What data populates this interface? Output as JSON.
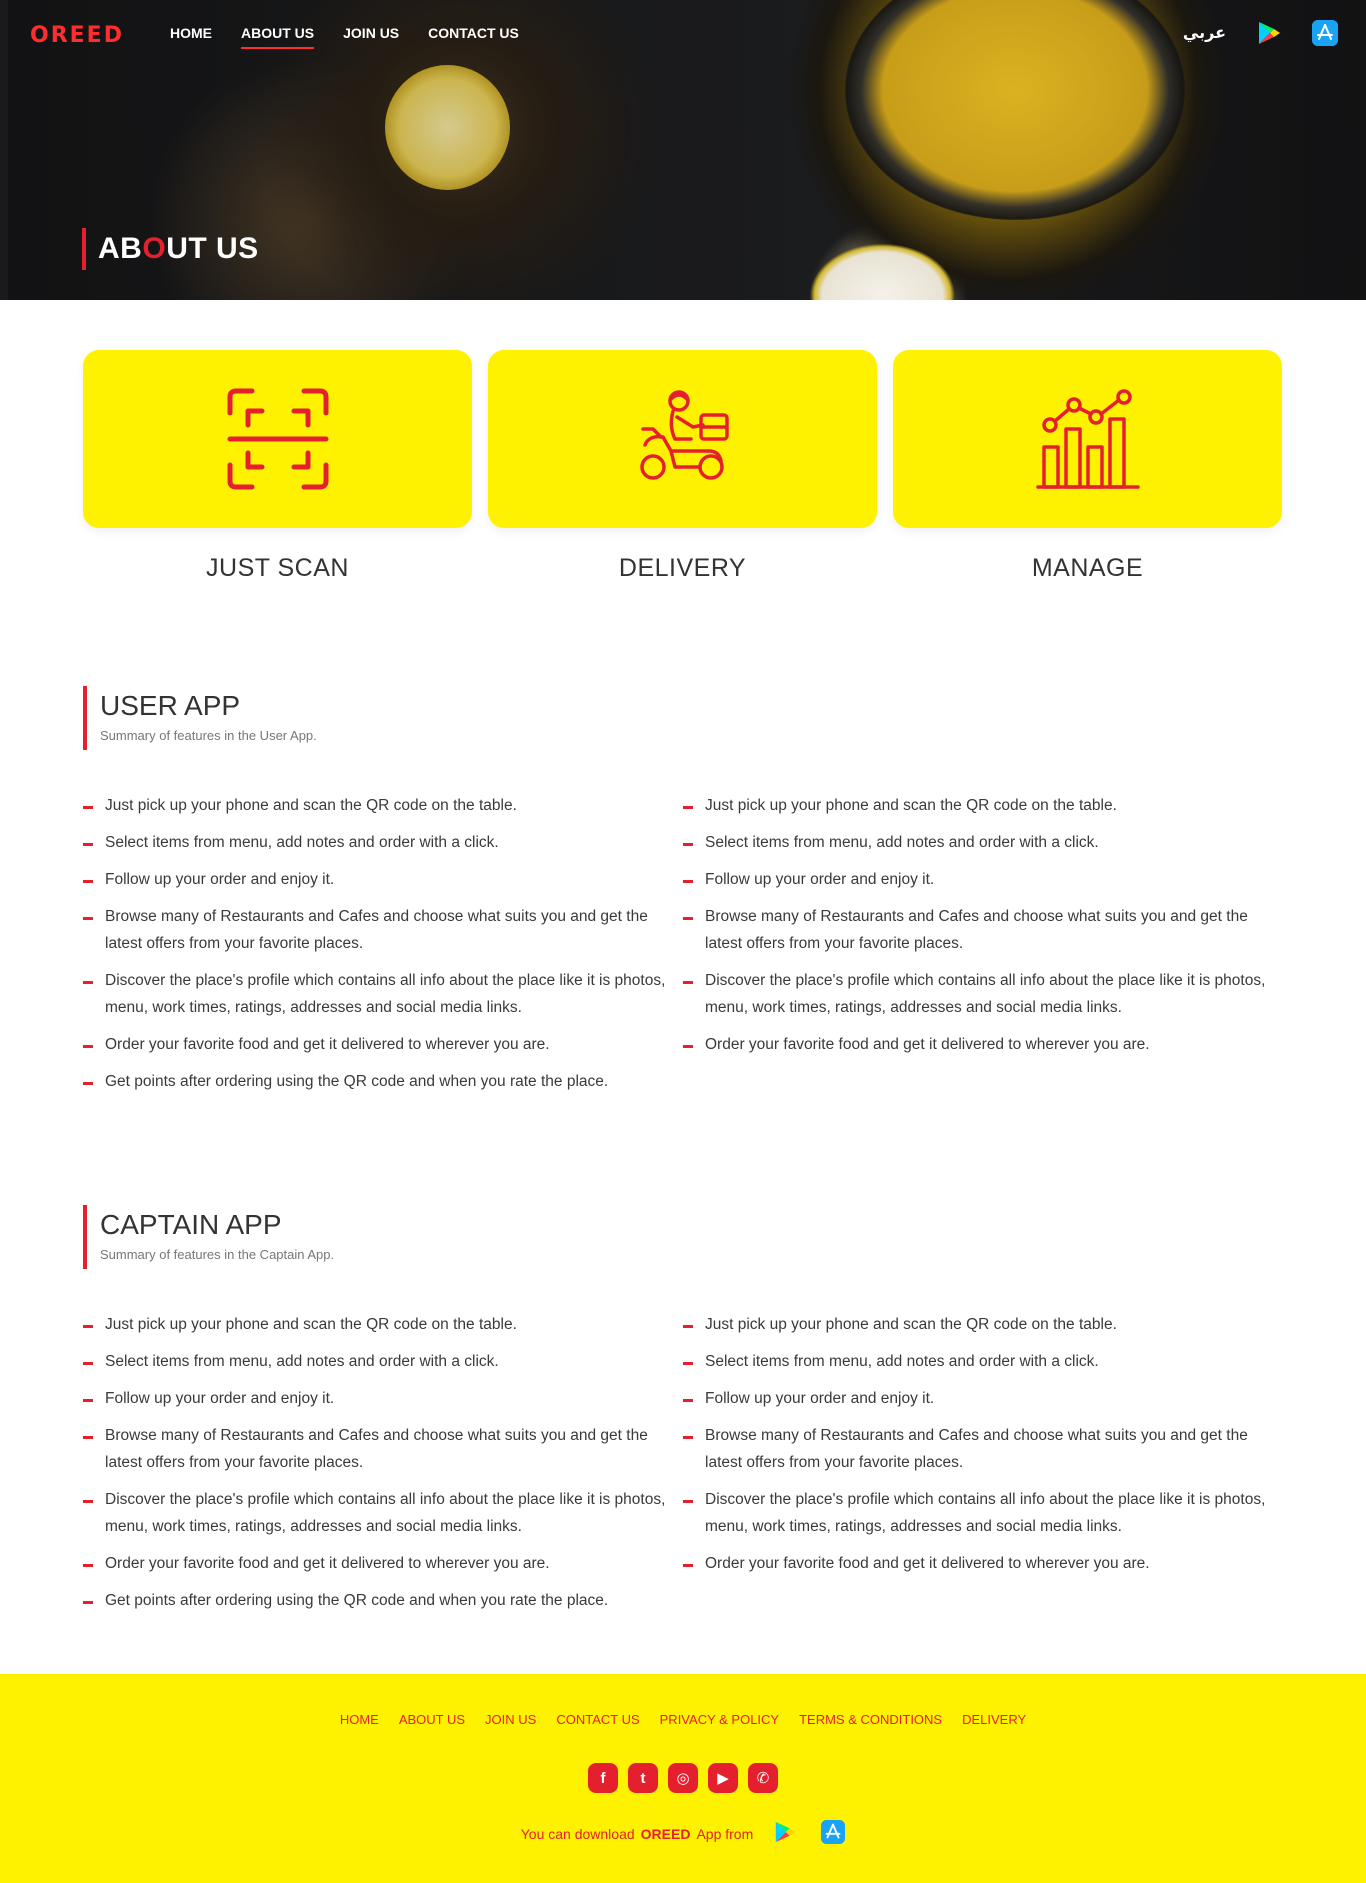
{
  "nav": {
    "logo": "OREED",
    "links": [
      {
        "label": "HOME",
        "active": false
      },
      {
        "label": "ABOUT US",
        "active": true
      },
      {
        "label": "JOIN US",
        "active": false
      },
      {
        "label": "CONTACT US",
        "active": false
      }
    ],
    "language": "عربي",
    "icons": [
      "google-play-icon",
      "app-store-icon"
    ]
  },
  "hero": {
    "title_part1": "AB",
    "title_accent": "O",
    "title_part2": "UT US"
  },
  "features": [
    {
      "title": "JUST SCAN",
      "icon": "qr-scan-icon"
    },
    {
      "title": "DELIVERY",
      "icon": "delivery-scooter-icon"
    },
    {
      "title": "MANAGE",
      "icon": "analytics-chart-icon"
    }
  ],
  "user_app": {
    "title": "USER APP",
    "subtitle": "Summary of features in the User App.",
    "left": [
      "Just pick up your phone and scan the QR code on the table.",
      "Select items from menu, add notes and order with a click.",
      "Follow up your order and enjoy it.",
      "Browse many of Restaurants and Cafes and choose what suits you and get the latest offers from your favorite places.",
      "Discover the place's profile which contains all info about the place like it is photos, menu, work times, ratings, addresses and social media links.",
      "Order your favorite food and get it delivered to wherever you are.",
      "Get points after ordering using the QR code and when you rate the place."
    ],
    "right": [
      "Just pick up your phone and scan the QR code on the table.",
      "Select items from menu, add notes and order with a click.",
      "Follow up your order and enjoy it.",
      "Browse many of Restaurants and Cafes and choose what suits you and get the latest offers from your favorite places.",
      "Discover the place's profile which contains all info about the place like it is photos, menu, work times, ratings, addresses and social media links.",
      "Order your favorite food and get it delivered to wherever you are."
    ]
  },
  "captain_app": {
    "title": "CAPTAIN APP",
    "subtitle": "Summary of features in the Captain App.",
    "left": [
      "Just pick up your phone and scan the QR code on the table.",
      "Select items from menu, add notes and order with a click.",
      "Follow up your order and enjoy it.",
      "Browse many of Restaurants and Cafes and choose what suits you and get the latest offers from your favorite places.",
      "Discover the place's profile which contains all info about the place like it is photos, menu, work times, ratings, addresses and social media links.",
      "Order your favorite food and get it delivered to wherever you are.",
      "Get points after ordering using the QR code and when you rate the place."
    ],
    "right": [
      "Just pick up your phone and scan the QR code on the table.",
      "Select items from menu, add notes and order with a click.",
      "Follow up your order and enjoy it.",
      "Browse many of Restaurants and Cafes and choose what suits you and get the latest offers from your favorite places.",
      "Discover the place's profile which contains all info about the place like it is photos, menu, work times, ratings, addresses and social media links.",
      "Order your favorite food and get it delivered to wherever you are."
    ]
  },
  "footer": {
    "links": [
      "HOME",
      "ABOUT US",
      "JOIN US",
      "CONTACT US",
      "PRIVACY & POLICY",
      "TERMS & CONDITIONS",
      "DELIVERY"
    ],
    "socials": [
      {
        "name": "facebook-icon",
        "glyph": "f"
      },
      {
        "name": "twitter-icon",
        "glyph": "t"
      },
      {
        "name": "instagram-icon",
        "glyph": "◎"
      },
      {
        "name": "youtube-icon",
        "glyph": "▶"
      },
      {
        "name": "whatsapp-icon",
        "glyph": "✆"
      }
    ],
    "download_prefix": "You can download",
    "download_brand": "OREED",
    "download_suffix": "App from"
  },
  "colors": {
    "accent_red": "#e5202e",
    "brand_yellow": "#fff200",
    "hero_dark": "#1a1a1c"
  }
}
